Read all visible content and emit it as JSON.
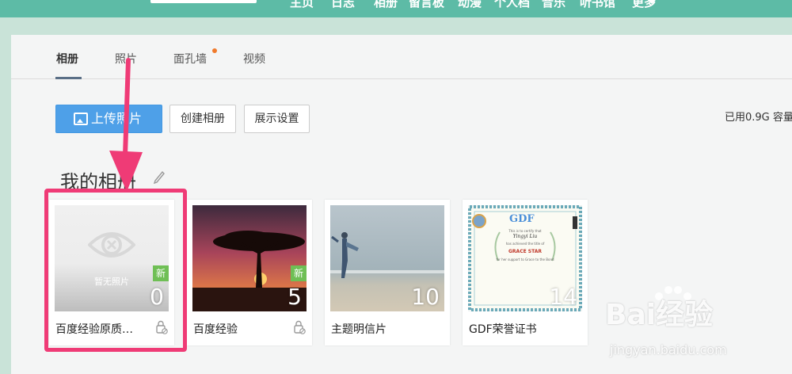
{
  "header": {
    "nav": [
      "主页",
      "日志",
      "相册",
      "留言板",
      "动漫",
      "个人档",
      "音乐",
      "听书馆",
      "更多"
    ]
  },
  "tabs": [
    {
      "label": "相册",
      "active": true
    },
    {
      "label": "照片",
      "active": false
    },
    {
      "label": "面孔墙",
      "active": false,
      "notification_dot": true
    },
    {
      "label": "视频",
      "active": false
    }
  ],
  "toolbar": {
    "upload_label": "上传照片",
    "create_label": "创建相册",
    "display_label": "展示设置",
    "quota_text": "已用0.9G 容量"
  },
  "section": {
    "title": "我的相册"
  },
  "albums": [
    {
      "name": "百度经验原质…",
      "count": "0",
      "is_new": true,
      "empty_text": "暂无照片",
      "thumb": "empty",
      "locked": true,
      "highlighted": true
    },
    {
      "name": "百度经验",
      "count": "5",
      "is_new": true,
      "thumb": "sunset-tree",
      "locked": true
    },
    {
      "name": "主题明信片",
      "count": "10",
      "is_new": false,
      "thumb": "beach-figure",
      "locked": false
    },
    {
      "name": "GDF荣誉证书",
      "count": "14",
      "is_new": false,
      "thumb": "certificate",
      "locked": false
    }
  ],
  "badge_new_label": "新",
  "certificate": {
    "logo": "GDF",
    "award": "GRACE STAR",
    "line1": "This is to certify that",
    "name": "Yingyi Liu",
    "line2": "has achieved the title of",
    "line3": "for her support to Grace to the Bond"
  },
  "watermark": {
    "brand": "Bai经验",
    "url": "jingyan.baidu.com"
  },
  "colors": {
    "accent": "#4ea0e8",
    "highlight": "#ef3b76",
    "header": "#5dbba6",
    "new_badge": "#6fbf55"
  }
}
